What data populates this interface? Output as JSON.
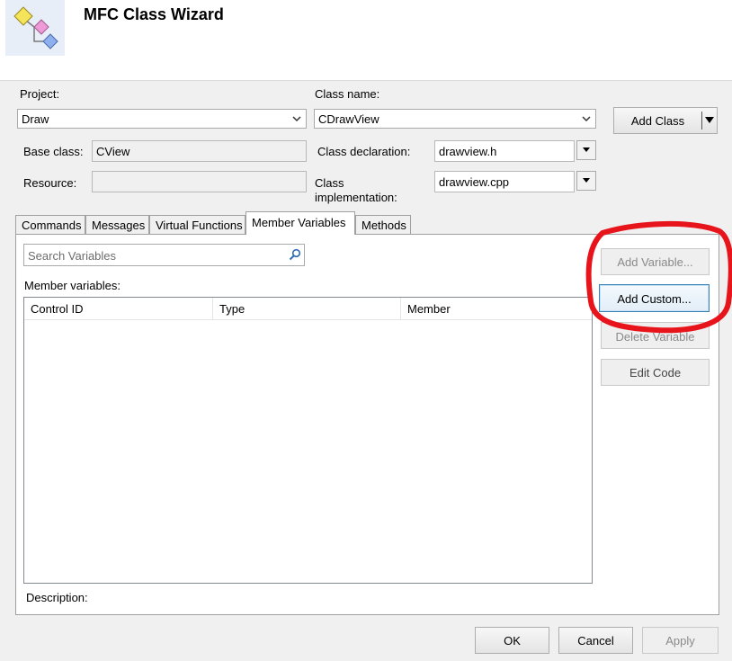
{
  "window": {
    "title": "MFC Class Wizard"
  },
  "project": {
    "label": "Project:",
    "value": "Draw"
  },
  "class_name": {
    "label": "Class name:",
    "value": "CDrawView"
  },
  "add_class_label": "Add Class",
  "base_class": {
    "label": "Base class:",
    "value": "CView"
  },
  "class_declaration": {
    "label": "Class declaration:",
    "value": "drawview.h"
  },
  "resource": {
    "label": "Resource:",
    "value": ""
  },
  "class_implementation": {
    "label_line1": "Class",
    "label_line2": "implementation:",
    "value": "drawview.cpp"
  },
  "tabs": [
    {
      "label": "Commands"
    },
    {
      "label": "Messages"
    },
    {
      "label": "Virtual Functions"
    },
    {
      "label": "Member Variables"
    },
    {
      "label": "Methods"
    }
  ],
  "active_tab": "Member Variables",
  "search": {
    "placeholder": "Search Variables"
  },
  "member_variables": {
    "label": "Member variables:",
    "columns": [
      "Control ID",
      "Type",
      "Member"
    ],
    "rows": []
  },
  "side_buttons": {
    "add_variable": "Add Variable...",
    "add_custom": "Add Custom...",
    "delete_variable": "Delete Variable",
    "edit_code": "Edit Code"
  },
  "description_label": "Description:",
  "footer": {
    "ok": "OK",
    "cancel": "Cancel",
    "apply": "Apply"
  },
  "colors": {
    "annotation_circle": "#e8141b",
    "focus_border": "#3c7fb1"
  }
}
